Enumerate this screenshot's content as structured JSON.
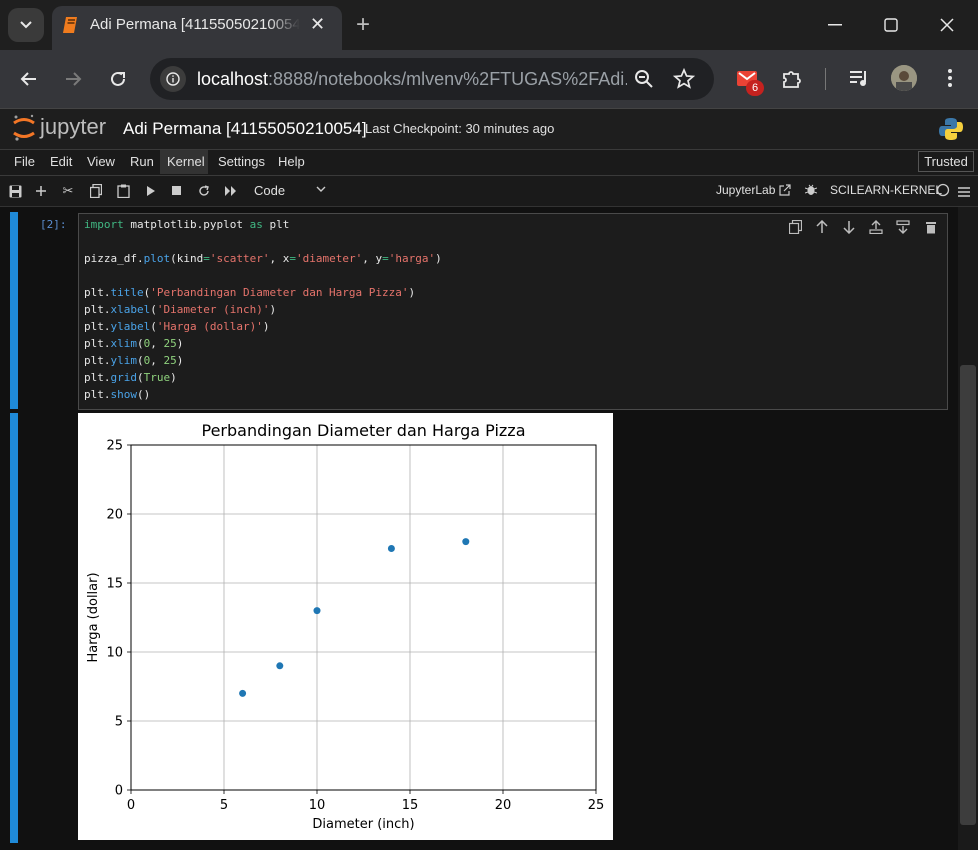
{
  "browser": {
    "tab_title": "Adi Permana [41155050210054]",
    "url_host": "localhost",
    "url_rest": ":8888/notebooks/mlvenv%2FTUGAS%2FAdi...",
    "extension_badge": "6"
  },
  "jupyter": {
    "logo_text": "jupyter",
    "notebook_name": "Adi Permana [41155050210054]",
    "checkpoint": "Last Checkpoint: 30 minutes ago",
    "menu": [
      "File",
      "Edit",
      "View",
      "Run",
      "Kernel",
      "Settings",
      "Help"
    ],
    "trusted": "Trusted",
    "cell_type": "Code",
    "jupyterlab_link": "JupyterLab",
    "kernel": "SCILEARN-KERNEL"
  },
  "cell": {
    "prompt": "[2]:",
    "code": [
      [
        [
          "import",
          "kw"
        ],
        [
          " matplotlib.pyplot ",
          "pl"
        ],
        [
          "as",
          "kw"
        ],
        [
          " plt",
          "pl"
        ]
      ],
      [],
      [
        [
          "pizza_df.",
          "pl"
        ],
        [
          "plot",
          "fn"
        ],
        [
          "(kind",
          "pl"
        ],
        [
          "=",
          "kw"
        ],
        [
          "'scatter'",
          "str"
        ],
        [
          ", x",
          "pl"
        ],
        [
          "=",
          "kw"
        ],
        [
          "'diameter'",
          "str"
        ],
        [
          ", y",
          "pl"
        ],
        [
          "=",
          "kw"
        ],
        [
          "'harga'",
          "str"
        ],
        [
          ")",
          "pl"
        ]
      ],
      [],
      [
        [
          "plt.",
          "pl"
        ],
        [
          "title",
          "fn"
        ],
        [
          "(",
          "pl"
        ],
        [
          "'Perbandingan Diameter dan Harga Pizza'",
          "str"
        ],
        [
          ")",
          "pl"
        ]
      ],
      [
        [
          "plt.",
          "pl"
        ],
        [
          "xlabel",
          "fn"
        ],
        [
          "(",
          "pl"
        ],
        [
          "'Diameter (inch)'",
          "str"
        ],
        [
          ")",
          "pl"
        ]
      ],
      [
        [
          "plt.",
          "pl"
        ],
        [
          "ylabel",
          "fn"
        ],
        [
          "(",
          "pl"
        ],
        [
          "'Harga (dollar)'",
          "str"
        ],
        [
          ")",
          "pl"
        ]
      ],
      [
        [
          "plt.",
          "pl"
        ],
        [
          "xlim",
          "fn"
        ],
        [
          "(",
          "pl"
        ],
        [
          "0",
          "num"
        ],
        [
          ", ",
          "pl"
        ],
        [
          "25",
          "num"
        ],
        [
          ")",
          "pl"
        ]
      ],
      [
        [
          "plt.",
          "pl"
        ],
        [
          "ylim",
          "fn"
        ],
        [
          "(",
          "pl"
        ],
        [
          "0",
          "num"
        ],
        [
          ", ",
          "pl"
        ],
        [
          "25",
          "num"
        ],
        [
          ")",
          "pl"
        ]
      ],
      [
        [
          "plt.",
          "pl"
        ],
        [
          "grid",
          "fn"
        ],
        [
          "(",
          "pl"
        ],
        [
          "True",
          "num"
        ],
        [
          ")",
          "pl"
        ]
      ],
      [
        [
          "plt.",
          "pl"
        ],
        [
          "show",
          "fn"
        ],
        [
          "()",
          "pl"
        ]
      ]
    ]
  },
  "chart_data": {
    "type": "scatter",
    "title": "Perbandingan Diameter dan Harga Pizza",
    "xlabel": "Diameter (inch)",
    "ylabel": "Harga (dollar)",
    "xlim": [
      0,
      25
    ],
    "ylim": [
      0,
      25
    ],
    "grid": true,
    "xticks": [
      0,
      5,
      10,
      15,
      20,
      25
    ],
    "yticks": [
      0,
      5,
      10,
      15,
      20,
      25
    ],
    "point_color": "#1f77b4",
    "x": [
      6,
      8,
      10,
      14,
      18
    ],
    "y": [
      7,
      9,
      13,
      17.5,
      18
    ]
  }
}
